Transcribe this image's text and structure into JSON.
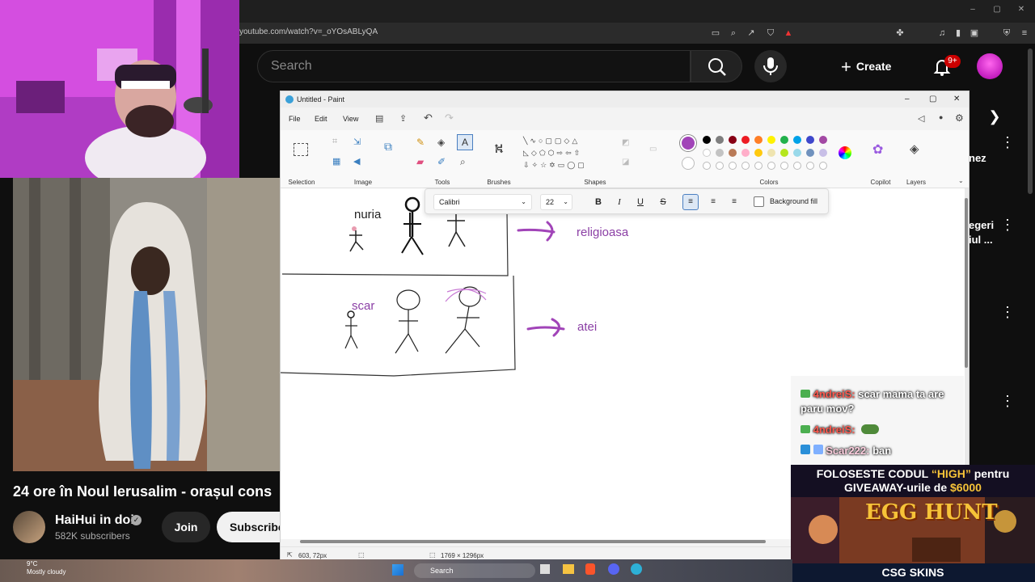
{
  "browser": {
    "url": "youtube.com/watch?v=_oYOsABLyQA"
  },
  "youtube": {
    "search_placeholder": "Search",
    "create_label": "Create",
    "notification_count": "9+",
    "video_title": "24 ore în Noul Ierusalim - orașul cons",
    "channel_name": "HaiHui in doi",
    "subscribers": "582K subscribers",
    "join_label": "Join",
    "subscribe_label": "Subscribe",
    "side_text_1": "nez",
    "side_text_2a": "egeri",
    "side_text_2b": "iul ..."
  },
  "paint": {
    "window_title": "Untitled - Paint",
    "menu": [
      "File",
      "Edit",
      "View"
    ],
    "groups": {
      "selection": "Selection",
      "image": "Image",
      "tools": "Tools",
      "brushes": "Brushes",
      "shapes": "Shapes",
      "colors": "Colors",
      "copilot": "Copilot",
      "layers": "Layers"
    },
    "text_toolbar": {
      "font": "Calibri",
      "size": "22",
      "bold": "B",
      "italic": "I",
      "underline": "U",
      "strike": "S",
      "background_fill": "Background fill"
    },
    "canvas": {
      "label_nuria": "nuria",
      "label_religioasa": "religioasa",
      "label_scar": "scar",
      "label_atei": "atei"
    },
    "status": {
      "position": "603, 72px",
      "dimensions": "1769 × 1296px"
    },
    "colors": {
      "selected": "#a144b8",
      "palette_row1": [
        "#000000",
        "#7f7f7f",
        "#880015",
        "#ed1c24",
        "#ff7f27",
        "#fff200",
        "#22b14c",
        "#00a2e8",
        "#3f48cc",
        "#a349a4"
      ],
      "palette_row2": [
        "#ffffff",
        "#c3c3c3",
        "#b97a57",
        "#ffaec9",
        "#ffc90e",
        "#efe4b0",
        "#b5e61d",
        "#99d9ea",
        "#7092be",
        "#c8bfe7"
      ]
    }
  },
  "chat": {
    "messages": [
      {
        "user": "4ndreiS:",
        "text": "scar mama ta are paru mov?"
      },
      {
        "user": "4ndreiS:",
        "text": ""
      },
      {
        "user": "Scar222:",
        "text": "ban"
      }
    ]
  },
  "promo": {
    "line1a": "FOLOSESTE CODUL ",
    "line1_code": "“HIGH”",
    "line1b": " pentru",
    "line2a": "GIVEAWAY-urile de ",
    "line2_amount": "$6000",
    "event": "EGG HUNT",
    "brand": "CSG SKINS"
  },
  "taskbar": {
    "temperature": "9°C",
    "weather": "Mostly cloudy",
    "search": "Search"
  }
}
